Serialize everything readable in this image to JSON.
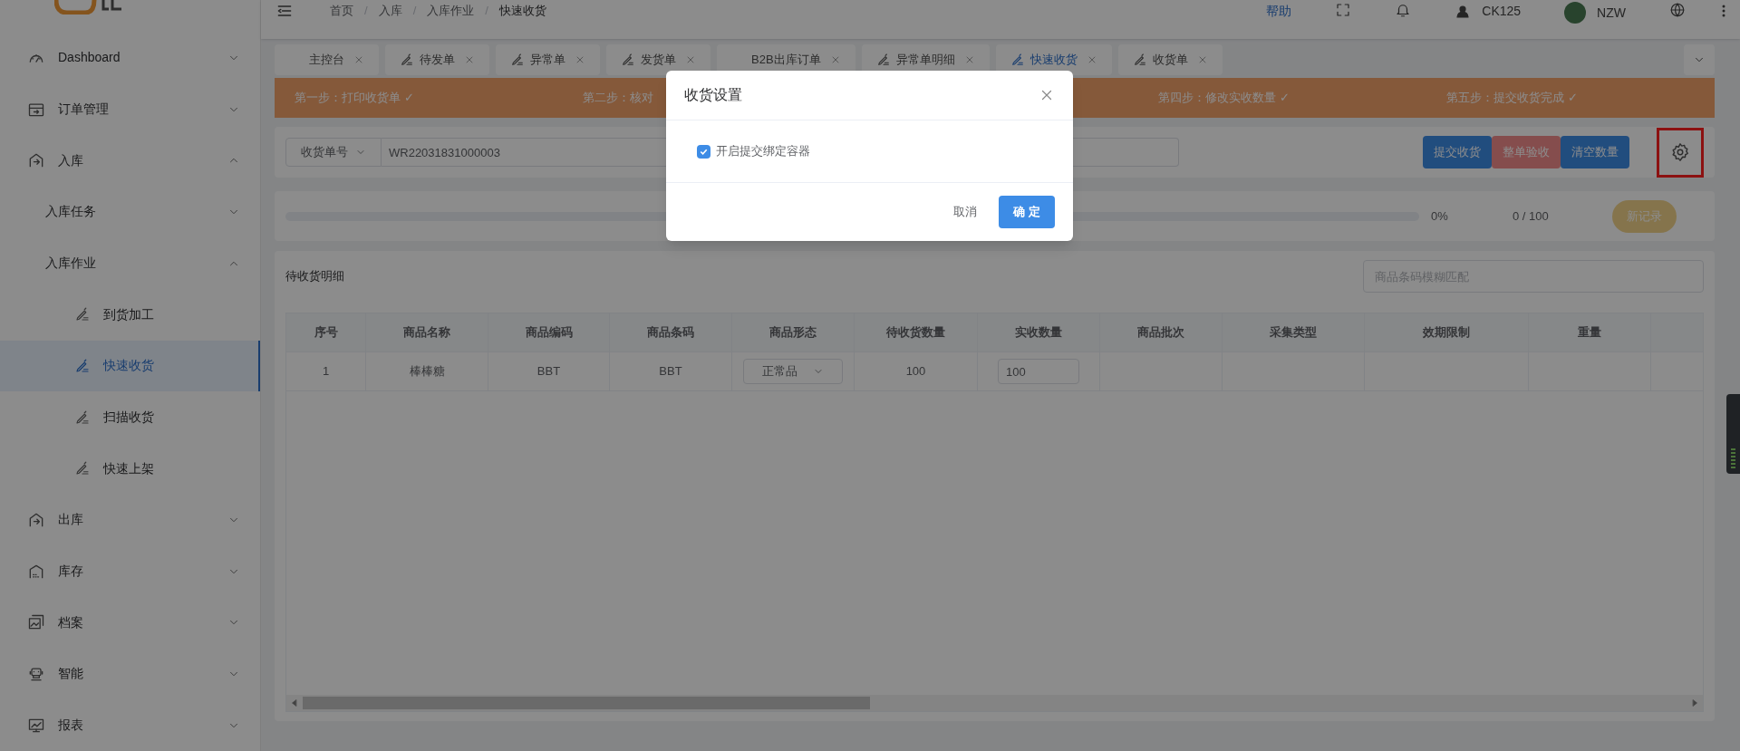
{
  "header": {
    "breadcrumb": [
      {
        "kind": "link",
        "text": "首页"
      },
      {
        "kind": "separator",
        "text": "/"
      },
      {
        "kind": "link",
        "text": "入库"
      },
      {
        "kind": "separator",
        "text": "/"
      },
      {
        "kind": "link",
        "text": "入库作业"
      },
      {
        "kind": "separator",
        "text": "/"
      },
      {
        "kind": "current",
        "text": "快速收货"
      }
    ],
    "help": "帮助",
    "user": "CK125",
    "account": "NZW"
  },
  "sidebar": {
    "items": [
      {
        "label": "Dashboard",
        "expanded": false
      },
      {
        "label": "订单管理",
        "expanded": false
      },
      {
        "label": "入库",
        "expanded": true,
        "children": [
          {
            "label": "入库任务",
            "expanded": false
          },
          {
            "label": "入库作业",
            "expanded": true,
            "children": [
              {
                "label": "到货加工",
                "selected": false
              },
              {
                "label": "快速收货",
                "selected": true
              },
              {
                "label": "扫描收货",
                "selected": false
              },
              {
                "label": "快速上架",
                "selected": false
              }
            ]
          }
        ]
      },
      {
        "label": "出库",
        "expanded": false
      },
      {
        "label": "库存",
        "expanded": false
      },
      {
        "label": "档案",
        "expanded": false
      },
      {
        "label": "智能",
        "expanded": false
      },
      {
        "label": "报表",
        "expanded": false
      }
    ]
  },
  "tabs": [
    {
      "label": "主控台",
      "icon": false,
      "selected": false
    },
    {
      "label": "待发单",
      "icon": true,
      "selected": false
    },
    {
      "label": "异常单",
      "icon": true,
      "selected": false
    },
    {
      "label": "发货单",
      "icon": true,
      "selected": false
    },
    {
      "label": "B2B出库订单",
      "icon": false,
      "selected": false
    },
    {
      "label": "异常单明细",
      "icon": true,
      "selected": false
    },
    {
      "label": "快速收货",
      "icon": true,
      "selected": true
    },
    {
      "label": "收货单",
      "icon": true,
      "selected": false
    }
  ],
  "steps": [
    "第一步：打印收货单 ✓",
    "第二步：核对",
    "第四步：修改实收数量 ✓",
    "第五步：提交收货完成 ✓"
  ],
  "toolbar": {
    "field_type": "收货单号",
    "order_number": "WR22031831000003",
    "buttons": [
      {
        "label": "提交收货",
        "kind": "primary"
      },
      {
        "label": "整单验收",
        "kind": "danger"
      },
      {
        "label": "清空数量",
        "kind": "primary"
      }
    ]
  },
  "progress": {
    "level": 0,
    "percent": "0%",
    "count": "0 / 100",
    "button": "新记录"
  },
  "details": {
    "title": "待收货明细",
    "search": {
      "placeholder": "商品条码模糊匹配"
    },
    "table": {
      "columns": [
        "序号",
        "商品名称",
        "商品编码",
        "商品条码",
        "商品形态",
        "待收货数量",
        "实收数量",
        "商品批次",
        "采集类型",
        "效期限制",
        "重量",
        ""
      ],
      "rows": [
        [
          "1",
          "棒棒糖",
          "BBT",
          "BBT",
          "正常品",
          "100",
          "100",
          "",
          "",
          "",
          "",
          ""
        ]
      ]
    }
  },
  "dialog": {
    "title": "收货设置",
    "option": {
      "label": "开启提交绑定容器",
      "checked": true
    },
    "cancel": "取消",
    "confirm": "确 定"
  }
}
